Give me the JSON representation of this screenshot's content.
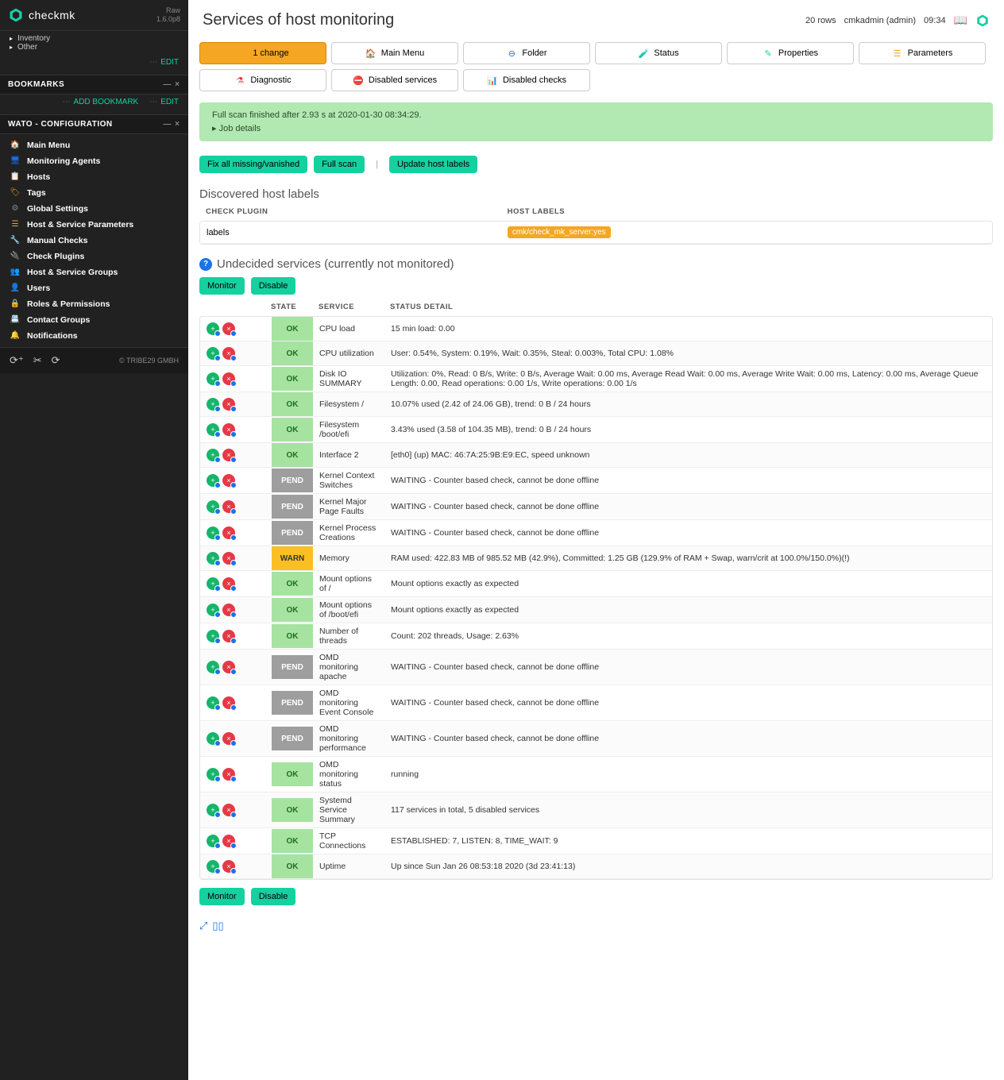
{
  "brand": {
    "name": "checkmk",
    "edition": "Raw",
    "version": "1.6.0p8"
  },
  "sidebar": {
    "top_items": [
      {
        "label": "Inventory",
        "expanded": false
      },
      {
        "label": "Other",
        "expanded": false
      }
    ],
    "top_edit": "EDIT",
    "bookmarks": {
      "title": "BOOKMARKS",
      "add": "ADD BOOKMARK",
      "edit": "EDIT"
    },
    "wato": {
      "title": "WATO - CONFIGURATION",
      "items": [
        {
          "label": "Main Menu",
          "icon": "home",
          "color": "#1a73e8"
        },
        {
          "label": "Monitoring Agents",
          "icon": "agent",
          "color": "#1a73e8"
        },
        {
          "label": "Hosts",
          "icon": "host",
          "color": "#1a73e8"
        },
        {
          "label": "Tags",
          "icon": "tag",
          "color": "#f5a623"
        },
        {
          "label": "Global Settings",
          "icon": "gear",
          "color": "#888"
        },
        {
          "label": "Host & Service Parameters",
          "icon": "list",
          "color": "#f5a623"
        },
        {
          "label": "Manual Checks",
          "icon": "wrench",
          "color": "#e63946"
        },
        {
          "label": "Check Plugins",
          "icon": "plug",
          "color": "#f5a623"
        },
        {
          "label": "Host & Service Groups",
          "icon": "group",
          "color": "#1a73e8"
        },
        {
          "label": "Users",
          "icon": "user",
          "color": "#9b59b6"
        },
        {
          "label": "Roles & Permissions",
          "icon": "lock",
          "color": "#f5a623"
        },
        {
          "label": "Contact Groups",
          "icon": "contacts",
          "color": "#888"
        },
        {
          "label": "Notifications",
          "icon": "bell",
          "color": "#f5c542"
        }
      ]
    },
    "footer": {
      "copyright": "© TRIBE29 GMBH"
    }
  },
  "header": {
    "title": "Services of host monitoring",
    "rows": "20 rows",
    "user": "cmkadmin (admin)",
    "time": "09:34"
  },
  "actions": {
    "row1": [
      {
        "key": "changes",
        "label": "1 change",
        "icon": "warn",
        "primary": true
      },
      {
        "key": "main",
        "label": "Main Menu",
        "icon": "home"
      },
      {
        "key": "folder",
        "label": "Folder",
        "icon": "folder"
      },
      {
        "key": "status",
        "label": "Status",
        "icon": "status"
      },
      {
        "key": "properties",
        "label": "Properties",
        "icon": "pencil"
      }
    ],
    "row2": [
      {
        "key": "parameters",
        "label": "Parameters",
        "icon": "list"
      },
      {
        "key": "diagnostic",
        "label": "Diagnostic",
        "icon": "flask"
      },
      {
        "key": "disabled-services",
        "label": "Disabled services",
        "icon": "no"
      },
      {
        "key": "disabled-checks",
        "label": "Disabled checks",
        "icon": "bars"
      }
    ]
  },
  "notice": {
    "text": "Full scan finished after 2.93 s at 2020-01-30 08:34:29.",
    "details": "Job details"
  },
  "pills": {
    "fix": "Fix all missing/vanished",
    "scan": "Full scan",
    "update": "Update host labels"
  },
  "labels_section": {
    "title": "Discovered host labels",
    "col_plugin": "CHECK PLUGIN",
    "col_labels": "HOST LABELS",
    "plugin": "labels",
    "chip": "cmk/check_mk_server:yes"
  },
  "undecided": {
    "title": "Undecided services (currently not monitored)",
    "monitor": "Monitor",
    "disable": "Disable",
    "cols": {
      "state": "STATE",
      "service": "SERVICE",
      "detail": "STATUS DETAIL"
    }
  },
  "services": [
    {
      "state": "OK",
      "name": "CPU load",
      "detail": "15 min load: 0.00"
    },
    {
      "state": "OK",
      "name": "CPU utilization",
      "detail": "User: 0.54%, System: 0.19%, Wait: 0.35%, Steal: 0.003%, Total CPU: 1.08%"
    },
    {
      "state": "OK",
      "name": "Disk IO SUMMARY",
      "detail": "Utilization: 0%, Read: 0 B/s, Write: 0 B/s, Average Wait: 0.00 ms, Average Read Wait: 0.00 ms, Average Write Wait: 0.00 ms, Latency: 0.00 ms, Average Queue Length: 0.00, Read operations: 0.00 1/s, Write operations: 0.00 1/s"
    },
    {
      "state": "OK",
      "name": "Filesystem /",
      "detail": "10.07% used (2.42 of 24.06 GB), trend: 0 B / 24 hours"
    },
    {
      "state": "OK",
      "name": "Filesystem /boot/efi",
      "detail": "3.43% used (3.58 of 104.35 MB), trend: 0 B / 24 hours"
    },
    {
      "state": "OK",
      "name": "Interface 2",
      "detail": "[eth0] (up) MAC: 46:7A:25:9B:E9:EC, speed unknown"
    },
    {
      "state": "PEND",
      "name": "Kernel Context Switches",
      "detail": "WAITING - Counter based check, cannot be done offline"
    },
    {
      "state": "PEND",
      "name": "Kernel Major Page Faults",
      "detail": "WAITING - Counter based check, cannot be done offline"
    },
    {
      "state": "PEND",
      "name": "Kernel Process Creations",
      "detail": "WAITING - Counter based check, cannot be done offline"
    },
    {
      "state": "WARN",
      "name": "Memory",
      "detail": "RAM used: 422.83 MB of 985.52 MB (42.9%), Committed: 1.25 GB (129.9% of RAM + Swap, warn/crit at 100.0%/150.0%)(!)"
    },
    {
      "state": "OK",
      "name": "Mount options of /",
      "detail": "Mount options exactly as expected"
    },
    {
      "state": "OK",
      "name": "Mount options of /boot/efi",
      "detail": "Mount options exactly as expected"
    },
    {
      "state": "OK",
      "name": "Number of threads",
      "detail": "Count: 202 threads, Usage: 2.63%"
    },
    {
      "state": "PEND",
      "name": "OMD monitoring apache",
      "detail": "WAITING - Counter based check, cannot be done offline"
    },
    {
      "state": "PEND",
      "name": "OMD monitoring Event Console",
      "detail": "WAITING - Counter based check, cannot be done offline"
    },
    {
      "state": "PEND",
      "name": "OMD monitoring performance",
      "detail": "WAITING - Counter based check, cannot be done offline"
    },
    {
      "state": "OK",
      "name": "OMD monitoring status",
      "detail": "running"
    },
    {
      "state": "OK",
      "name": "Systemd Service Summary",
      "detail": "117 services in total, 5 disabled services"
    },
    {
      "state": "OK",
      "name": "TCP Connections",
      "detail": "ESTABLISHED: 7, LISTEN: 8, TIME_WAIT: 9"
    },
    {
      "state": "OK",
      "name": "Uptime",
      "detail": "Up since Sun Jan 26 08:53:18 2020 (3d 23:41:13)"
    }
  ]
}
